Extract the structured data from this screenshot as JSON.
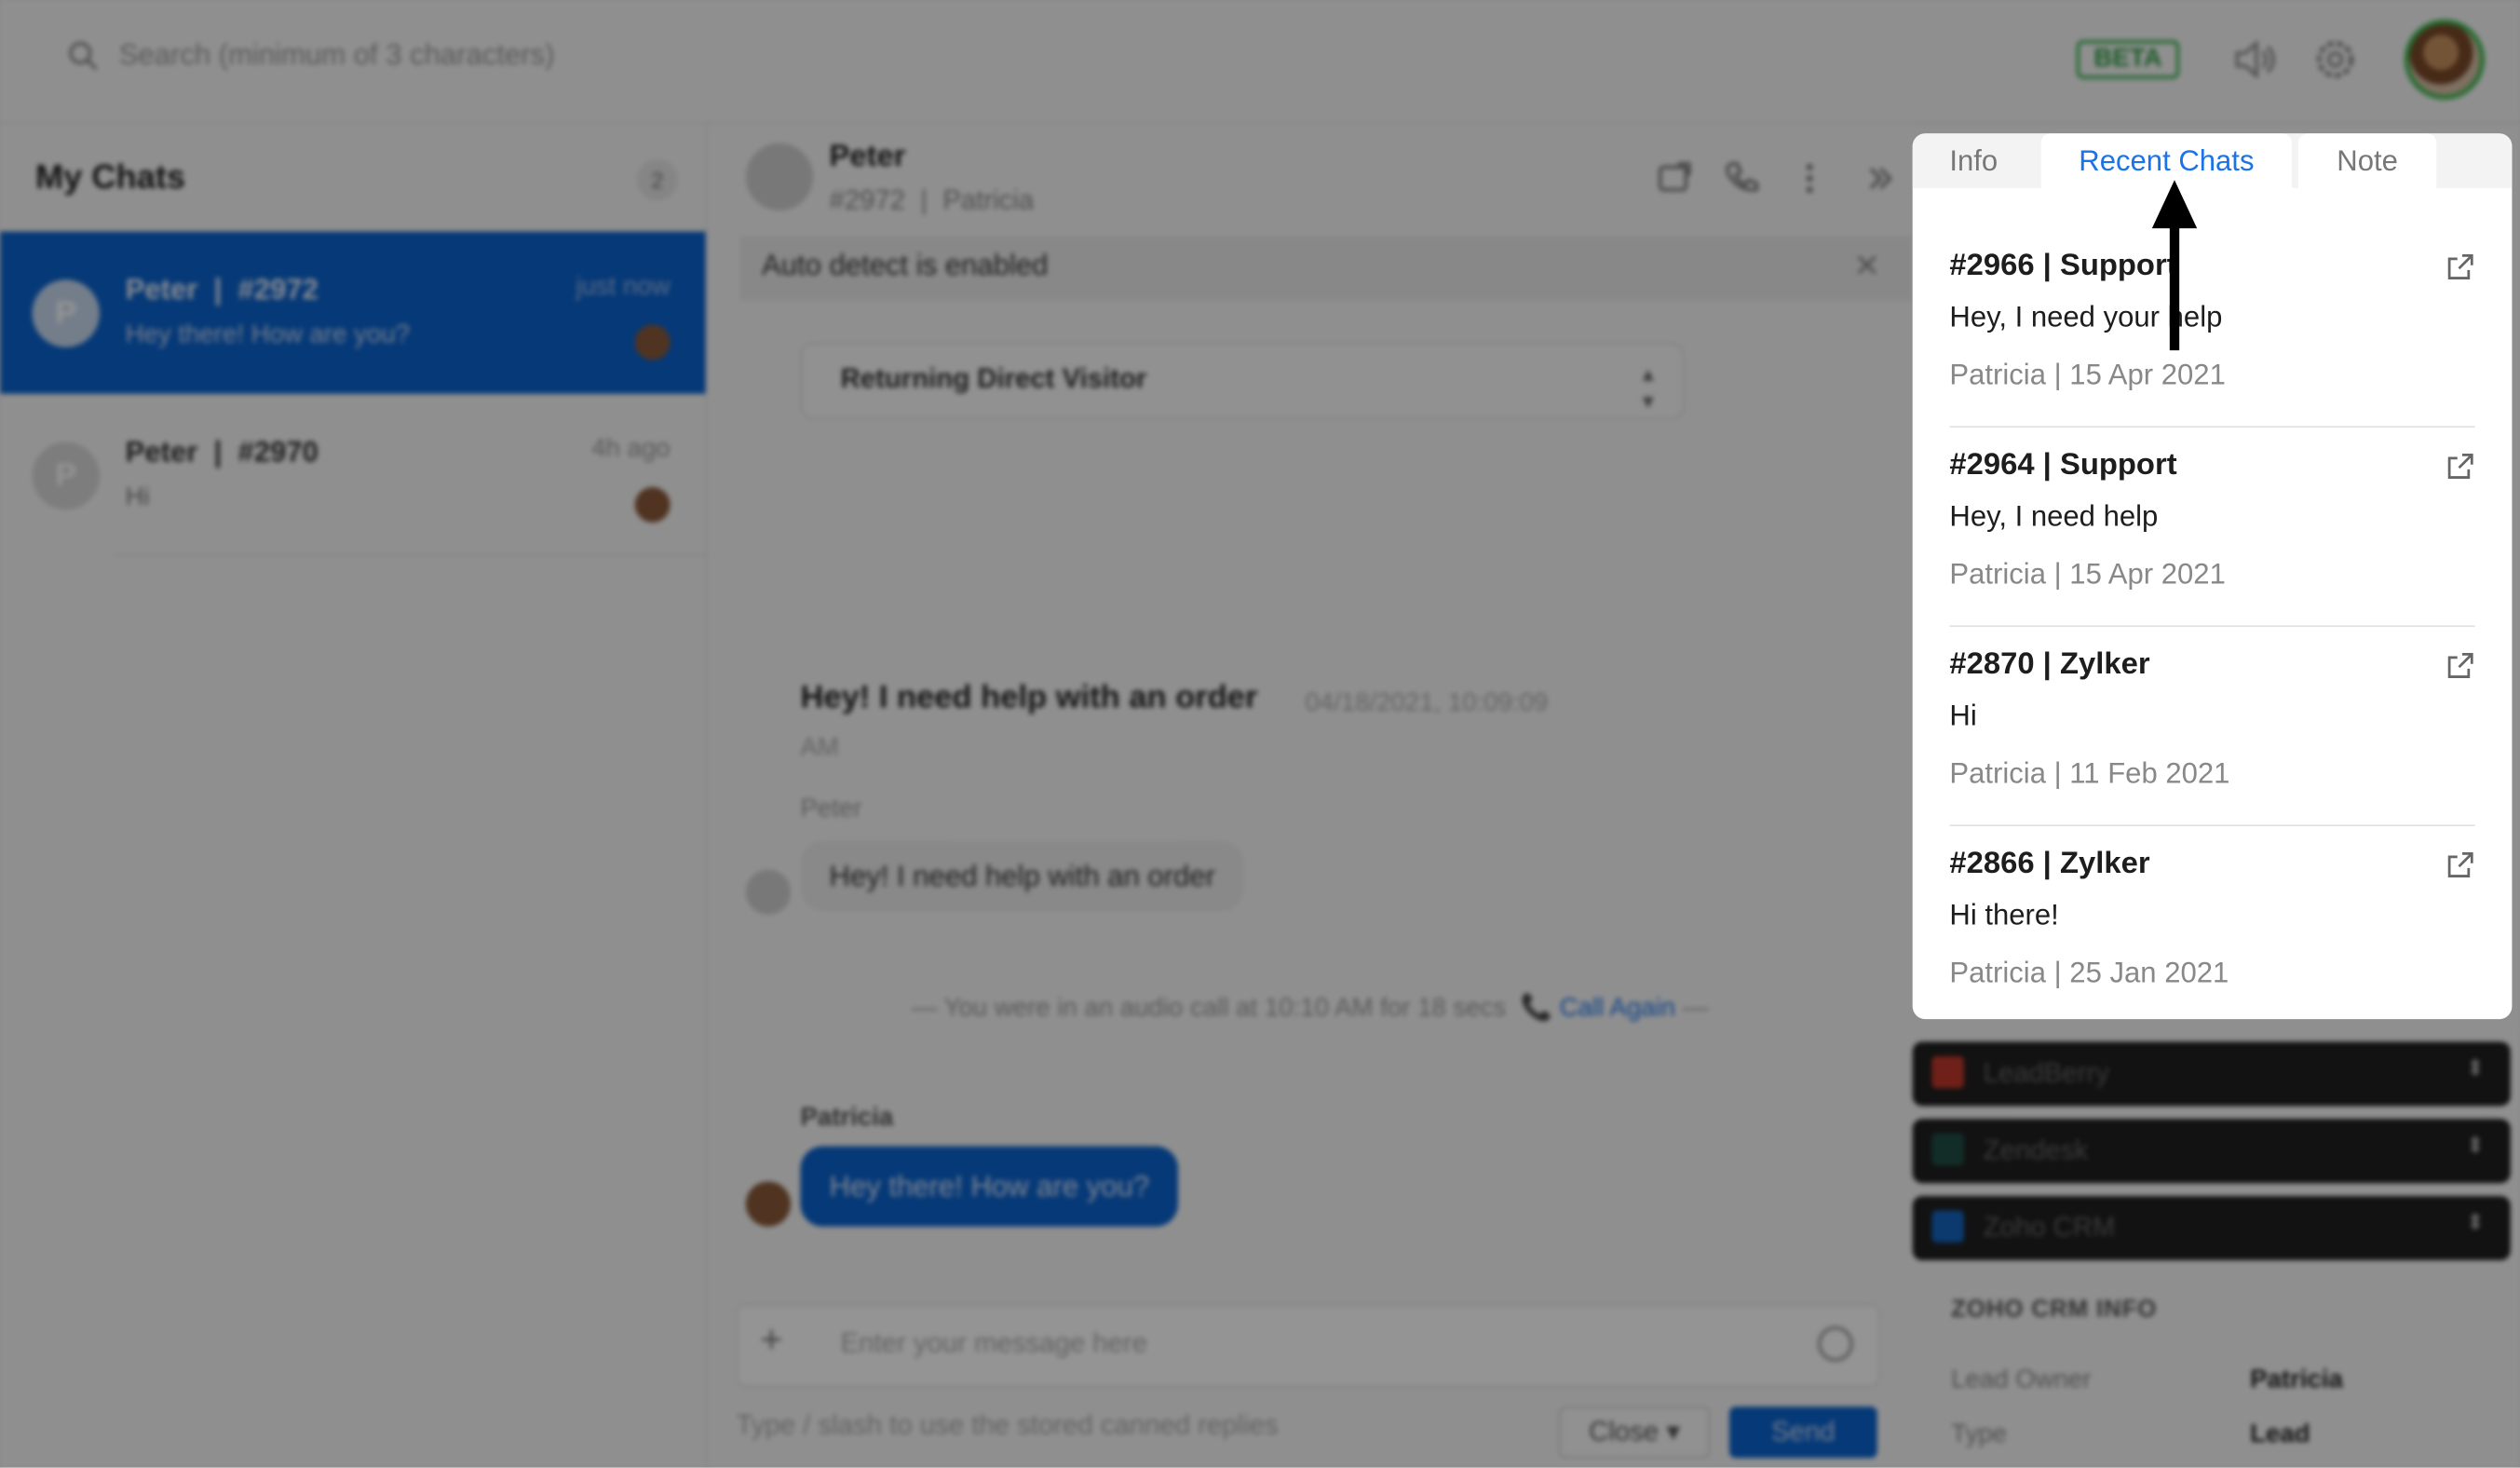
{
  "topbar": {
    "search_placeholder": "Search (minimum of 3 characters)",
    "beta_label": "BETA"
  },
  "sidebar": {
    "title": "My Chats",
    "count": "2",
    "chats": [
      {
        "avatar": "P",
        "name": "Peter",
        "id": "#2972",
        "time": "just now",
        "message": "Hey there! How are you?"
      },
      {
        "avatar": "P",
        "name": "Peter",
        "id": "#2970",
        "time": "4h ago",
        "message": "Hi"
      }
    ]
  },
  "conversation": {
    "visitor_name": "Peter",
    "chat_id": "#2972",
    "agent": "Patricia",
    "banner": "Auto detect is enabled",
    "visitor_type": "Returning Direct Visitor",
    "question_title": "Hey! I need help with an order",
    "question_time": "04/18/2021, 10:09:09",
    "question_time_ampm": "AM",
    "visitor_sender": "Peter",
    "visitor_message": "Hey! I need help with an order",
    "call_text": "You were in an audio call at 10:10 AM for 18 secs",
    "call_again": "Call Again",
    "agent_sender": "Patricia",
    "agent_message": "Hey there! How are you?",
    "composer_placeholder": "Enter your message here",
    "canned_hint": "Type / slash to use the stored canned replies",
    "close_label": "Close",
    "send_label": "Send"
  },
  "right_panel": {
    "integrations": [
      {
        "name": "LeadBerry",
        "color": "#c0392b"
      },
      {
        "name": "Zendesk",
        "color": "#1f4f46"
      },
      {
        "name": "Zoho CRM",
        "color": "#1565c0"
      }
    ],
    "crm_title": "ZOHO CRM INFO",
    "crm_rows": [
      {
        "label": "Lead Owner",
        "value": "Patricia"
      },
      {
        "label": "Type",
        "value": "Lead"
      }
    ]
  },
  "popup": {
    "tabs": [
      "Info",
      "Recent Chats",
      "Note"
    ],
    "active_tab": "Recent Chats",
    "entries": [
      {
        "header": "#2966 | Support",
        "body": "Hey, I need your help",
        "footer": "Patricia | 15 Apr 2021"
      },
      {
        "header": "#2964 | Support",
        "body": "Hey, I need help",
        "footer": "Patricia | 15 Apr 2021"
      },
      {
        "header": "#2870 | Zylker",
        "body": "Hi",
        "footer": "Patricia | 11 Feb 2021"
      },
      {
        "header": "#2866 | Zylker",
        "body": "Hi there!",
        "footer": "Patricia | 25 Jan 2021"
      }
    ]
  },
  "colors": {
    "accent": "#1a73e8",
    "active_chat": "#0b63ce",
    "beta_green": "#37b24d"
  },
  "icons": [
    "search-icon",
    "volume-icon",
    "gear-icon",
    "transfer-icon",
    "phone-icon",
    "more-icon",
    "expand-icon",
    "close-icon",
    "external-link-icon",
    "pointer-arrow-icon"
  ]
}
